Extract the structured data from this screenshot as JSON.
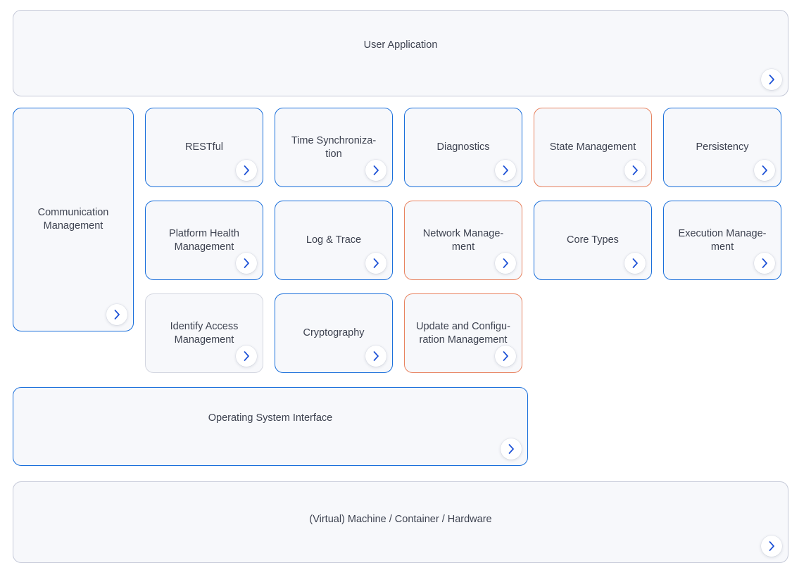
{
  "colors": {
    "blue": "#1a6fdb",
    "orange": "#e8825f",
    "grey": "#d3d6e0",
    "lavender": "#c5c9d8",
    "card_background": "#f7f8fb",
    "text": "#3d4250",
    "page_background": "#ffffff"
  },
  "diagram": {
    "title_layer": {
      "label": "User Application",
      "border": "lavender",
      "expand_icon": "chevron-right-icon"
    },
    "left_column": {
      "label": "Communication\nManagement",
      "label_lines": [
        "Communication",
        "Management"
      ],
      "border": "blue",
      "expand_icon": "chevron-right-icon"
    },
    "grid": {
      "rows": [
        [
          {
            "label": "RESTful",
            "lines": [
              "RESTful"
            ],
            "border": "blue",
            "expand_icon": "chevron-right-icon"
          },
          {
            "label": "Time Synchronization",
            "lines": [
              "Time Synchroniza-",
              "tion"
            ],
            "border": "blue",
            "expand_icon": "chevron-right-icon"
          },
          {
            "label": "Diagnostics",
            "lines": [
              "Diagnostics"
            ],
            "border": "blue",
            "expand_icon": "chevron-right-icon"
          },
          {
            "label": "State Management",
            "lines": [
              "State Management"
            ],
            "border": "orange",
            "expand_icon": "chevron-right-icon"
          },
          {
            "label": "Persistency",
            "lines": [
              "Persistency"
            ],
            "border": "blue",
            "expand_icon": "chevron-right-icon"
          }
        ],
        [
          {
            "label": "Platform Health Management",
            "lines": [
              "Platform Health",
              "Management"
            ],
            "border": "blue",
            "expand_icon": "chevron-right-icon"
          },
          {
            "label": "Log & Trace",
            "lines": [
              "Log & Trace"
            ],
            "border": "blue",
            "expand_icon": "chevron-right-icon"
          },
          {
            "label": "Network Management",
            "lines": [
              "Network Manage-",
              "ment"
            ],
            "border": "orange",
            "expand_icon": "chevron-right-icon"
          },
          {
            "label": "Core Types",
            "lines": [
              "Core Types"
            ],
            "border": "blue",
            "expand_icon": "chevron-right-icon"
          },
          {
            "label": "Execution Management",
            "lines": [
              "Execution Manage-",
              "ment"
            ],
            "border": "blue",
            "expand_icon": "chevron-right-icon"
          }
        ],
        [
          {
            "label": "Identify Access Management",
            "lines": [
              "Identify Access",
              "Management"
            ],
            "border": "grey",
            "expand_icon": "chevron-right-icon"
          },
          {
            "label": "Cryptography",
            "lines": [
              "Cryptography"
            ],
            "border": "blue",
            "expand_icon": "chevron-right-icon"
          },
          {
            "label": "Update and Configuration Management",
            "lines": [
              "Update and Configu-",
              "ration Management"
            ],
            "border": "orange",
            "expand_icon": "chevron-right-icon"
          }
        ]
      ]
    },
    "os_layer": {
      "label": "Operating System Interface",
      "border": "blue",
      "expand_icon": "chevron-right-icon"
    },
    "hardware_layer": {
      "label": "(Virtual) Machine / Container / Hardware",
      "border": "lavender",
      "expand_icon": "chevron-right-icon"
    }
  }
}
